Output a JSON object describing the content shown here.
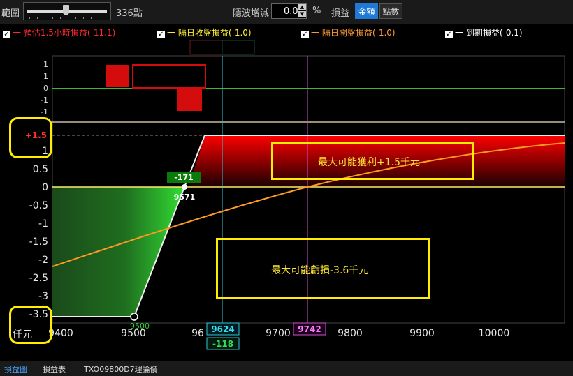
{
  "toolbar": {
    "range_label": "範圍",
    "range_value": "336點",
    "range_fraction": 0.45,
    "vol_label": "隱波增減",
    "vol_value": "0.0",
    "vol_unit": "%",
    "pl_label": "損益",
    "mode_amount": "金額",
    "mode_points": "點數"
  },
  "legend": [
    {
      "label": "一 預估1.5小時損益(-11.1)",
      "color": "#ff2a2a"
    },
    {
      "label": "一 隔日收盤損益(-1.0)",
      "color": "#ffee33"
    },
    {
      "label": "一 隔日開盤損益(-1.0)",
      "color": "#ff9933"
    },
    {
      "label": "一 到期損益(-0.1)",
      "color": "#ffffff"
    }
  ],
  "chart_data": {
    "type": "line",
    "x_ticks": [
      "9400",
      "9500",
      "96",
      "9700",
      "9800",
      "9900",
      "10000"
    ],
    "y_ticks": [
      "1",
      "0.5",
      "0",
      "-0.5",
      "-1",
      "-1.5",
      "-2",
      "-2.5",
      "-3",
      "-3.5"
    ],
    "y_unit": "仟元",
    "y_max_label": "+1.5",
    "series": [
      {
        "name": "到期損益",
        "x": [
          9380,
          9500,
          9570,
          9620,
          10100
        ],
        "y": [
          -3.5,
          -3.5,
          0,
          1.5,
          1.5
        ]
      },
      {
        "name": "隔日開盤損益",
        "x": [
          9380,
          9500,
          9600,
          9700,
          9742,
          9800,
          9900,
          10000,
          10100
        ],
        "y": [
          -2.2,
          -1.55,
          -0.95,
          -0.35,
          0,
          0.3,
          0.65,
          1.0,
          1.23
        ]
      }
    ],
    "top_panel": {
      "y_ticks": [
        "1",
        "1",
        "0",
        "-1",
        "-1"
      ],
      "bars": [
        {
          "x_from": 9460,
          "x_to": 9495,
          "value": 1,
          "filled": true
        },
        {
          "x_from": 9495,
          "x_to": 9600,
          "value": 1,
          "filled": false
        },
        {
          "x_from": 9560,
          "x_to": 9595,
          "value": -1,
          "filled": true
        }
      ]
    },
    "breakeven": {
      "x_label": "9571",
      "value_label": "-171"
    },
    "cursor_cyan": {
      "x_label": "9624",
      "value_label": "-118"
    },
    "cursor_pink": {
      "x_label": "9742"
    },
    "endpoint_x": "9500"
  },
  "annotations": {
    "max_profit": "最大可能獲利+1.5千元",
    "max_loss": "最大可能虧損-3.6千元"
  },
  "tabs": [
    "損益圖",
    "損益表",
    "TXO09800D7理論價"
  ]
}
